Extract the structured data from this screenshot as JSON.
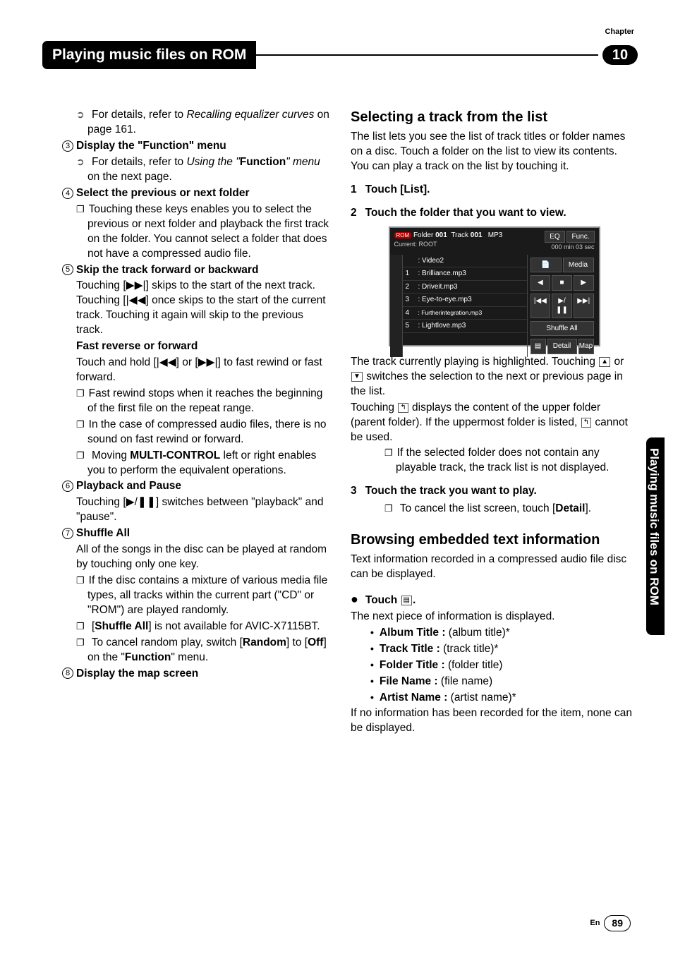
{
  "chapter_label": "Chapter",
  "chapter_number": "10",
  "header_title": "Playing music files on ROM",
  "side_tab_text": "Playing music files on ROM",
  "page_lang": "En",
  "page_number": "89",
  "left_col": {
    "l1a": "For details, refer to ",
    "l1b": "Recalling equalizer curves",
    "l1c": " on page 161.",
    "item3_title": "Display the \"Function\" menu",
    "l3a": "For details, refer to ",
    "l3b": "Using the \"",
    "l3c": "Function",
    "l3d": "\" menu",
    "l3e": " on the next page.",
    "item4_title": "Select the previous or next folder",
    "l4a": "Touching these keys enables you to select the previous or next folder and playback the first track on the folder. You cannot select a folder that does not have a compressed audio file.",
    "item5_title": "Skip the track forward or backward",
    "l5a": "Touching [▶▶|] skips to the start of the next track. Touching [|◀◀] once skips to the start of the current track. Touching it again will skip to the previous track.",
    "l5b_title": "Fast reverse or forward",
    "l5b": "Touch and hold [|◀◀] or [▶▶|] to fast rewind or fast forward.",
    "l5c": "Fast rewind stops when it reaches the beginning of the first file on the repeat range.",
    "l5d": "In the case of compressed audio files, there is no sound on fast rewind or forward.",
    "l5e_a": "Moving ",
    "l5e_b": "MULTI-CONTROL",
    "l5e_c": " left or right enables you to perform the equivalent operations.",
    "item6_title": "Playback and Pause",
    "l6a": "Touching [▶/❚❚] switches between \"playback\" and \"pause\".",
    "item7_title": "Shuffle All",
    "l7a": "All of the songs in the disc can be played at random by touching only one key.",
    "l7b": "If the disc contains a mixture of various media file types, all tracks within the current part (\"CD\" or \"ROM\") are played randomly.",
    "l7c_a": "[",
    "l7c_b": "Shuffle All",
    "l7c_c": "] is not available for AVIC-X7115BT.",
    "l7d_a": "To cancel random play, switch [",
    "l7d_b": "Random",
    "l7d_c": "] to [",
    "l7d_d": "Off",
    "l7d_e": "] on the \"",
    "l7d_f": "Function",
    "l7d_g": "\" menu.",
    "item8_title": "Display the map screen"
  },
  "right_col": {
    "sec1_title": "Selecting a track from the list",
    "sec1_intro": "The list lets you see the list of track titles or folder names on a disc. Touch a folder on the list to view its contents. You can play a track on the list by touching it.",
    "step1": "Touch [List].",
    "step2": "Touch the folder that you want to view.",
    "after_img1": "The track currently playing is highlighted. Touching ",
    "after_img2": " or ",
    "after_img3": " switches the selection to the next or previous page in the list.",
    "after_img4": "Touching ",
    "after_img5": " displays the content of the upper folder (parent folder). If the uppermost folder is listed, ",
    "after_img6": " cannot be used.",
    "note1": "If the selected folder does not contain any playable track, the track list is not displayed.",
    "step3": "Touch the track you want to play.",
    "step3_note_a": "To cancel the list screen, touch [",
    "step3_note_b": "Detail",
    "step3_note_c": "].",
    "sec2_title": "Browsing embedded text information",
    "sec2_intro": "Text information recorded in a compressed audio file disc can be displayed.",
    "touch_label": "Touch ",
    "touch_icon_suffix": ".",
    "next_piece": "The next piece of information is displayed.",
    "info_items": [
      {
        "label": "Album Title :",
        "desc": " (album title)*"
      },
      {
        "label": "Track Title :",
        "desc": " (track title)*"
      },
      {
        "label": "Folder Title :",
        "desc": " (folder title)"
      },
      {
        "label": "File Name :",
        "desc": " (file name)"
      },
      {
        "label": "Artist Name :",
        "desc": " (artist name)*"
      }
    ],
    "sec2_outro": "If no information has been recorded for the item, none can be displayed."
  },
  "screenshot": {
    "rom_label": "ROM",
    "folder": "Folder",
    "folder_no": "001",
    "track": "Track",
    "track_no": "001",
    "fmt": "MP3",
    "eq": "EQ",
    "func": "Func.",
    "current": "Current: ROOT",
    "time": "000 min 03 sec",
    "rows": [
      {
        "n": "",
        "t": ": Video2"
      },
      {
        "n": "1",
        "t": ": Brilliance.mp3"
      },
      {
        "n": "2",
        "t": ": Driveit.mp3"
      },
      {
        "n": "3",
        "t": ": Eye-to-eye.mp3"
      },
      {
        "n": "4",
        "t": ": Furtherintegration.mp3"
      },
      {
        "n": "5",
        "t": ": Lightlove.mp3"
      }
    ],
    "media": "Media",
    "prev": "◀",
    "stop": "■",
    "next": "▶",
    "rew": "|◀◀",
    "pp": "▶/❚❚",
    "ff": "▶▶|",
    "shuffle": "Shuffle All",
    "info": "▤",
    "detail": "Detail",
    "map": "Map"
  }
}
